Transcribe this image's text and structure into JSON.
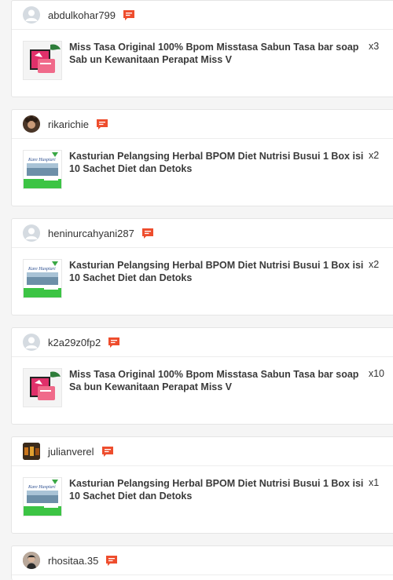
{
  "orders": [
    {
      "username": "abdulkohar799",
      "avatar": "default-avatar",
      "product": "Miss Tasa Original 100% Bpom Misstasa Sabun Tasa bar soap Sab un Kewanitaan Perapat Miss V",
      "qty": "x3",
      "thumb": "miss-tasa-soap"
    },
    {
      "username": "rikarichie",
      "avatar": "photo-avatar-curly",
      "product": "Kasturian Pelangsing Herbal BPOM Diet Nutrisi Busui 1 Box isi 10 Sachet Diet dan Detoks",
      "qty": "x2",
      "thumb": "kasturian-box"
    },
    {
      "username": "heninurcahyani287",
      "avatar": "default-avatar",
      "product": "Kasturian Pelangsing Herbal BPOM Diet Nutrisi Busui 1 Box isi 10 Sachet Diet dan Detoks",
      "qty": "x2",
      "thumb": "kasturian-box"
    },
    {
      "username": "k2a29z0fp2",
      "avatar": "default-avatar",
      "product": "Miss Tasa Original 100% Bpom Misstasa Sabun Tasa bar soap Sa bun Kewanitaan Perapat Miss V",
      "qty": "x10",
      "thumb": "miss-tasa-soap"
    },
    {
      "username": "julianverel",
      "avatar": "photo-avatar-dark",
      "product": "Kasturian Pelangsing Herbal BPOM Diet Nutrisi Busui 1 Box isi 10 Sachet Diet dan Detoks",
      "qty": "x1",
      "thumb": "kasturian-box"
    },
    {
      "username": "rhositaa.35",
      "avatar": "photo-avatar-woman",
      "product": "",
      "qty": "",
      "thumb": ""
    }
  ],
  "thumb_text": {
    "kasturian": "Kare Haspiari"
  },
  "colors": {
    "chat_icon": "#ee4d2d",
    "avatar_bg": "#d5dbe1"
  }
}
